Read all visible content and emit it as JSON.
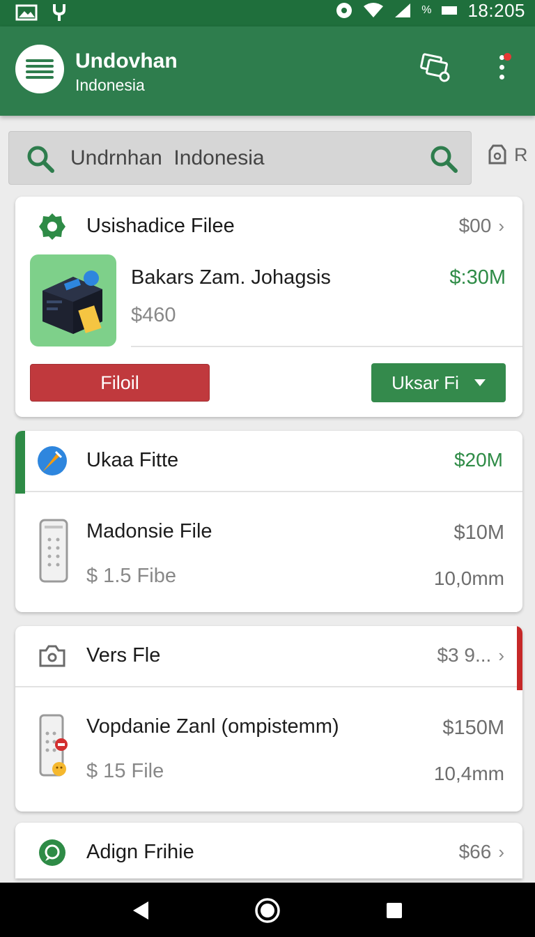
{
  "status_bar": {
    "time": "18:205",
    "battery_text": "%"
  },
  "app_bar": {
    "title": "Undovhan",
    "subtitle": "Indonesia"
  },
  "search": {
    "value": "Undrnhan  Indonesia",
    "side_label": "R"
  },
  "cards": [
    {
      "title": "Usishadice Filee",
      "value": "$00",
      "item": {
        "name": "Bakars Zam. Johagsis",
        "price": "$:30M",
        "subtitle": "$460"
      },
      "primary_button": "Filoil",
      "secondary_button": "Uksar Fi"
    },
    {
      "title": "Ukaa Fitte",
      "value": "$20M",
      "row": {
        "title": "Madonsie File",
        "subtitle": "$ 1.5  Fibe",
        "value": "$10M",
        "size": "10,0mm"
      }
    },
    {
      "title": "Vers Fle",
      "value": "$3 9...",
      "row": {
        "title": "Vopdanie Zanl (ompistemm)",
        "subtitle": "$ 15 File",
        "value": "$150M",
        "size": "10,4mm"
      }
    },
    {
      "title": "Adign Frihie",
      "value": "$66"
    }
  ],
  "colors": {
    "primary": "#2e7d4d",
    "status_bar": "#1f6f3c",
    "accent_green": "#2e8b46",
    "danger": "#c0393d"
  },
  "icons": [
    "menu-icon",
    "gallery-icon",
    "more-vert-icon",
    "search-icon",
    "filter-icon",
    "gear-icon",
    "compass-icon",
    "phone-icon",
    "camera-icon",
    "chat-icon",
    "back-icon",
    "home-icon",
    "recents-icon"
  ]
}
